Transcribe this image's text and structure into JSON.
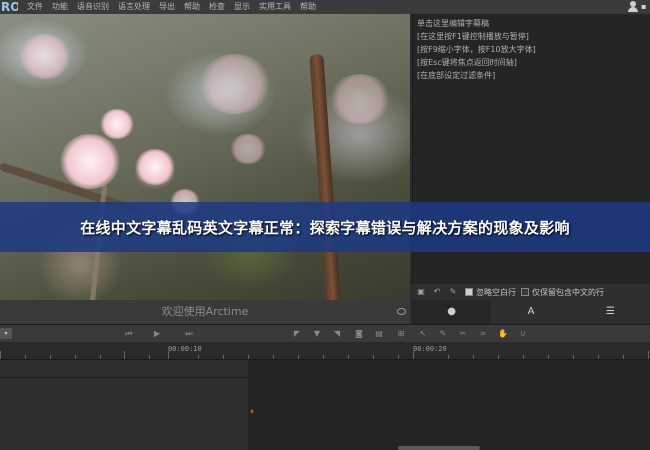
{
  "app": {
    "logo_text": "RO"
  },
  "menubar": {
    "items": [
      "文件",
      "功能",
      "语音识别",
      "语言处理",
      "导出",
      "帮助",
      "检查",
      "显示",
      "实用工具",
      "帮助"
    ]
  },
  "video": {
    "caption": "欢迎使用Arctime"
  },
  "editor": {
    "lines": [
      "单击这里编辑字幕稿",
      "[在这里按F1键控制播放与暂停]",
      "[按F9缩小字体，按F10放大字体]",
      "[按Esc键将焦点返回时间轴]",
      "[在底部设定过滤条件]"
    ]
  },
  "subtitle_toolbar": {
    "skip_blank_label": "忽略空白行",
    "skip_blank_checked": true,
    "keep_chinese_label": "仅保留包含中文的行",
    "keep_chinese_checked": false
  },
  "panel_tabs": [
    {
      "icon": "chat-icon",
      "glyph": "●"
    },
    {
      "icon": "text-style-icon",
      "glyph": "A"
    },
    {
      "icon": "list-icon",
      "glyph": "☰"
    }
  ],
  "timeline": {
    "ruler_labels": [
      "00:00:10",
      "00:00:20"
    ]
  },
  "overlay": {
    "headline": "在线中文字幕乱码英文字幕正常：探索字幕错误与解决方案的现象及影响",
    "color": "#1c3a84"
  }
}
